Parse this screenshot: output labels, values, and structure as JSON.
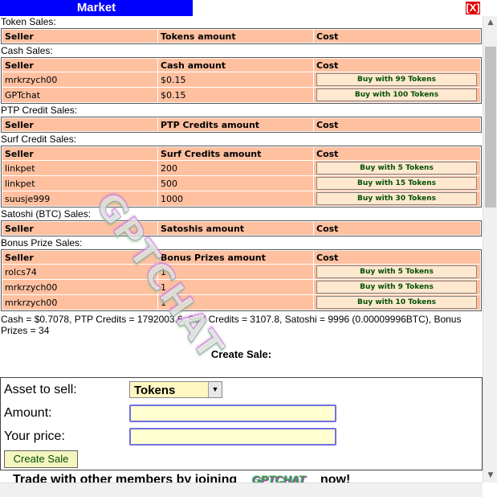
{
  "window": {
    "title": "Market",
    "close_label": "[X]"
  },
  "sections": {
    "token": {
      "label": "Token Sales:",
      "headers": [
        "Seller",
        "Tokens amount",
        "Cost"
      ],
      "rows": []
    },
    "cash": {
      "label": "Cash Sales:",
      "headers": [
        "Seller",
        "Cash amount",
        "Cost"
      ],
      "rows": [
        {
          "seller": "mrkrzych00",
          "amount": "$0.15",
          "cost": "Buy with 99 Tokens"
        },
        {
          "seller": "GPTchat",
          "amount": "$0.15",
          "cost": "Buy with 100 Tokens"
        }
      ]
    },
    "ptp": {
      "label": "PTP Credit Sales:",
      "headers": [
        "Seller",
        "PTP Credits amount",
        "Cost"
      ],
      "rows": []
    },
    "surf": {
      "label": "Surf Credit Sales:",
      "headers": [
        "Seller",
        "Surf Credits amount",
        "Cost"
      ],
      "rows": [
        {
          "seller": "linkpet",
          "amount": "200",
          "cost": "Buy with 5 Tokens"
        },
        {
          "seller": "linkpet",
          "amount": "500",
          "cost": "Buy with 15 Tokens"
        },
        {
          "seller": "suusje999",
          "amount": "1000",
          "cost": "Buy with 30 Tokens"
        }
      ]
    },
    "satoshi": {
      "label": "Satoshi (BTC) Sales:",
      "headers": [
        "Seller",
        "Satoshis amount",
        "Cost"
      ],
      "rows": []
    },
    "bonus": {
      "label": "Bonus Prize Sales:",
      "headers": [
        "Seller",
        "Bonus Prizes amount",
        "Cost"
      ],
      "rows": [
        {
          "seller": "rolcs74",
          "amount": "1",
          "cost": "Buy with 5 Tokens"
        },
        {
          "seller": "mrkrzych00",
          "amount": "1",
          "cost": "Buy with 9 Tokens"
        },
        {
          "seller": "mrkrzych00",
          "amount": "1",
          "cost": "Buy with 10 Tokens"
        }
      ]
    }
  },
  "balances": "Cash = $0.7078, PTP Credits = 1792003.6, Surf Credits = 3107.8, Satoshi = 9996 (0.00009996BTC), Bonus Prizes = 34",
  "create": {
    "title": "Create Sale:",
    "asset_label": "Asset to sell:",
    "asset_value": "Tokens",
    "amount_label": "Amount:",
    "amount_value": "",
    "price_label": "Your price:",
    "price_value": "",
    "button": "Create Sale"
  },
  "footer": {
    "pre": "Trade with other members by joining",
    "logo": "GPTCHAT",
    "post": "now!"
  },
  "watermark": "GPTCHAT",
  "colors": {
    "titlebar": "#0000ff",
    "close": "#e00000",
    "cell": "#ffc0a0",
    "button_text": "#005000"
  }
}
